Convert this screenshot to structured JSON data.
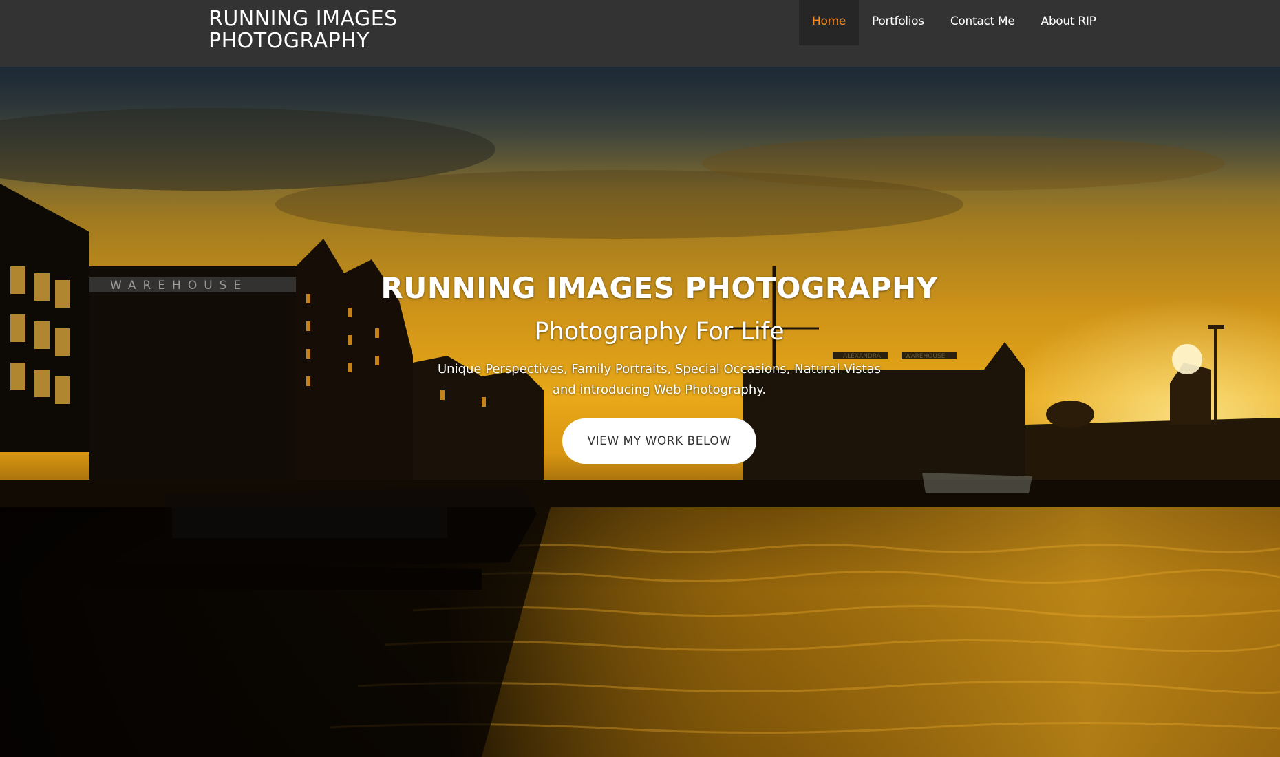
{
  "navbar": {
    "brand_line1": "RUNNING IMAGES",
    "brand_line2": "PHOTOGRAPHY",
    "links": [
      {
        "label": "Home",
        "active": true
      },
      {
        "label": "Portfolios",
        "active": false
      },
      {
        "label": "Contact Me",
        "active": false
      },
      {
        "label": "About RIP",
        "active": false
      }
    ],
    "bg_color": "#333333",
    "active_color": "#f58a1f"
  },
  "hero": {
    "title": "RUNNING IMAGES PHOTOGRAPHY",
    "subtitle": "Photography For Life",
    "desc_line1": "Unique Perspectives, Family Portraits, Special Occasions, Natural Vistas",
    "desc_line2": "and introducing Web Photography.",
    "cta_label": "VIEW MY WORK BELOW",
    "sign_warehouse": "WAREHOUSE",
    "sign_alexandra": "ALEXANDRA",
    "sign_warehouse2": "WAREHOUSE"
  }
}
